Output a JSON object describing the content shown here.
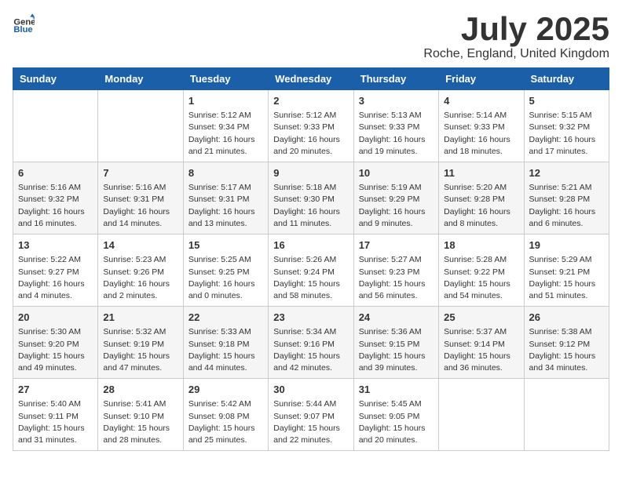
{
  "header": {
    "logo_general": "General",
    "logo_blue": "Blue",
    "month_title": "July 2025",
    "location": "Roche, England, United Kingdom"
  },
  "days_of_week": [
    "Sunday",
    "Monday",
    "Tuesday",
    "Wednesday",
    "Thursday",
    "Friday",
    "Saturday"
  ],
  "weeks": [
    [
      {
        "day": "",
        "info": ""
      },
      {
        "day": "",
        "info": ""
      },
      {
        "day": "1",
        "info": "Sunrise: 5:12 AM\nSunset: 9:34 PM\nDaylight: 16 hours\nand 21 minutes."
      },
      {
        "day": "2",
        "info": "Sunrise: 5:12 AM\nSunset: 9:33 PM\nDaylight: 16 hours\nand 20 minutes."
      },
      {
        "day": "3",
        "info": "Sunrise: 5:13 AM\nSunset: 9:33 PM\nDaylight: 16 hours\nand 19 minutes."
      },
      {
        "day": "4",
        "info": "Sunrise: 5:14 AM\nSunset: 9:33 PM\nDaylight: 16 hours\nand 18 minutes."
      },
      {
        "day": "5",
        "info": "Sunrise: 5:15 AM\nSunset: 9:32 PM\nDaylight: 16 hours\nand 17 minutes."
      }
    ],
    [
      {
        "day": "6",
        "info": "Sunrise: 5:16 AM\nSunset: 9:32 PM\nDaylight: 16 hours\nand 16 minutes."
      },
      {
        "day": "7",
        "info": "Sunrise: 5:16 AM\nSunset: 9:31 PM\nDaylight: 16 hours\nand 14 minutes."
      },
      {
        "day": "8",
        "info": "Sunrise: 5:17 AM\nSunset: 9:31 PM\nDaylight: 16 hours\nand 13 minutes."
      },
      {
        "day": "9",
        "info": "Sunrise: 5:18 AM\nSunset: 9:30 PM\nDaylight: 16 hours\nand 11 minutes."
      },
      {
        "day": "10",
        "info": "Sunrise: 5:19 AM\nSunset: 9:29 PM\nDaylight: 16 hours\nand 9 minutes."
      },
      {
        "day": "11",
        "info": "Sunrise: 5:20 AM\nSunset: 9:28 PM\nDaylight: 16 hours\nand 8 minutes."
      },
      {
        "day": "12",
        "info": "Sunrise: 5:21 AM\nSunset: 9:28 PM\nDaylight: 16 hours\nand 6 minutes."
      }
    ],
    [
      {
        "day": "13",
        "info": "Sunrise: 5:22 AM\nSunset: 9:27 PM\nDaylight: 16 hours\nand 4 minutes."
      },
      {
        "day": "14",
        "info": "Sunrise: 5:23 AM\nSunset: 9:26 PM\nDaylight: 16 hours\nand 2 minutes."
      },
      {
        "day": "15",
        "info": "Sunrise: 5:25 AM\nSunset: 9:25 PM\nDaylight: 16 hours\nand 0 minutes."
      },
      {
        "day": "16",
        "info": "Sunrise: 5:26 AM\nSunset: 9:24 PM\nDaylight: 15 hours\nand 58 minutes."
      },
      {
        "day": "17",
        "info": "Sunrise: 5:27 AM\nSunset: 9:23 PM\nDaylight: 15 hours\nand 56 minutes."
      },
      {
        "day": "18",
        "info": "Sunrise: 5:28 AM\nSunset: 9:22 PM\nDaylight: 15 hours\nand 54 minutes."
      },
      {
        "day": "19",
        "info": "Sunrise: 5:29 AM\nSunset: 9:21 PM\nDaylight: 15 hours\nand 51 minutes."
      }
    ],
    [
      {
        "day": "20",
        "info": "Sunrise: 5:30 AM\nSunset: 9:20 PM\nDaylight: 15 hours\nand 49 minutes."
      },
      {
        "day": "21",
        "info": "Sunrise: 5:32 AM\nSunset: 9:19 PM\nDaylight: 15 hours\nand 47 minutes."
      },
      {
        "day": "22",
        "info": "Sunrise: 5:33 AM\nSunset: 9:18 PM\nDaylight: 15 hours\nand 44 minutes."
      },
      {
        "day": "23",
        "info": "Sunrise: 5:34 AM\nSunset: 9:16 PM\nDaylight: 15 hours\nand 42 minutes."
      },
      {
        "day": "24",
        "info": "Sunrise: 5:36 AM\nSunset: 9:15 PM\nDaylight: 15 hours\nand 39 minutes."
      },
      {
        "day": "25",
        "info": "Sunrise: 5:37 AM\nSunset: 9:14 PM\nDaylight: 15 hours\nand 36 minutes."
      },
      {
        "day": "26",
        "info": "Sunrise: 5:38 AM\nSunset: 9:12 PM\nDaylight: 15 hours\nand 34 minutes."
      }
    ],
    [
      {
        "day": "27",
        "info": "Sunrise: 5:40 AM\nSunset: 9:11 PM\nDaylight: 15 hours\nand 31 minutes."
      },
      {
        "day": "28",
        "info": "Sunrise: 5:41 AM\nSunset: 9:10 PM\nDaylight: 15 hours\nand 28 minutes."
      },
      {
        "day": "29",
        "info": "Sunrise: 5:42 AM\nSunset: 9:08 PM\nDaylight: 15 hours\nand 25 minutes."
      },
      {
        "day": "30",
        "info": "Sunrise: 5:44 AM\nSunset: 9:07 PM\nDaylight: 15 hours\nand 22 minutes."
      },
      {
        "day": "31",
        "info": "Sunrise: 5:45 AM\nSunset: 9:05 PM\nDaylight: 15 hours\nand 20 minutes."
      },
      {
        "day": "",
        "info": ""
      },
      {
        "day": "",
        "info": ""
      }
    ]
  ]
}
